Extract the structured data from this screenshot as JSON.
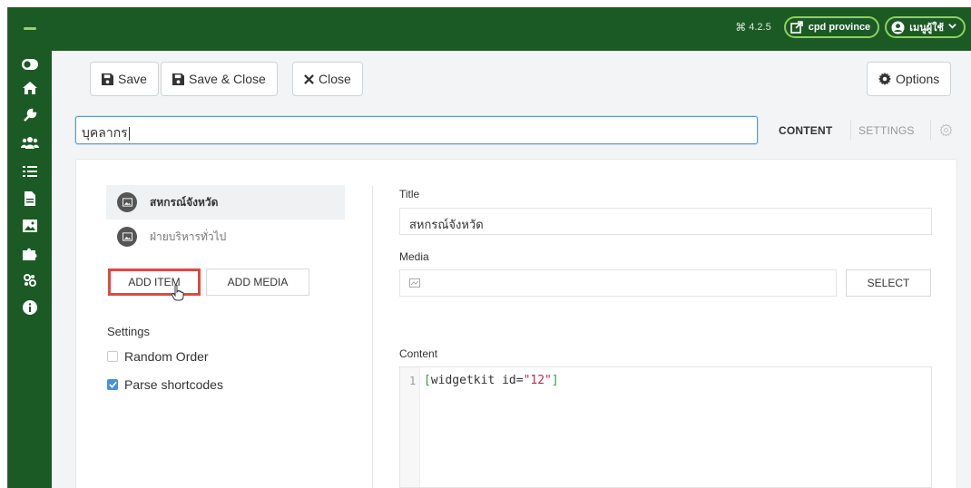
{
  "topbar": {
    "version": "4.2.5",
    "site_link_label": "cpd province",
    "user_menu_label": "เมนูผู้ใช้",
    "colors": {
      "bar": "#1b5a24",
      "pill_border": "#8ed15a"
    }
  },
  "sidebar": {
    "icons": [
      "toggle-icon",
      "home-icon",
      "wrench-icon",
      "users-icon",
      "list-icon",
      "file-icon",
      "image-icon",
      "puzzle-icon",
      "users-group-icon",
      "info-icon"
    ]
  },
  "toolbar": {
    "save_label": "Save",
    "save_close_label": "Save & Close",
    "close_label": "Close",
    "options_label": "Options"
  },
  "title_field": {
    "value": "บุคลากร"
  },
  "tabs": {
    "content_label": "CONTENT",
    "settings_label": "SETTINGS"
  },
  "items": [
    {
      "label": "สหกรณ์จังหวัด",
      "active": true
    },
    {
      "label": "ฝ่ายบริหารทั่วไป",
      "active": false
    }
  ],
  "buttons": {
    "add_item": "ADD ITEM",
    "add_media": "ADD MEDIA",
    "select": "SELECT"
  },
  "settings": {
    "heading": "Settings",
    "random_order": {
      "label": "Random Order",
      "checked": false
    },
    "parse_shortcodes": {
      "label": "Parse shortcodes",
      "checked": true
    }
  },
  "form": {
    "title_label": "Title",
    "title_value": "สหกรณ์จังหวัด",
    "media_label": "Media",
    "content_label": "Content"
  },
  "editor": {
    "line_number": "1",
    "code_open": "[",
    "code_body": "widgetkit id=",
    "code_string": "\"12\"",
    "code_close": "]"
  }
}
